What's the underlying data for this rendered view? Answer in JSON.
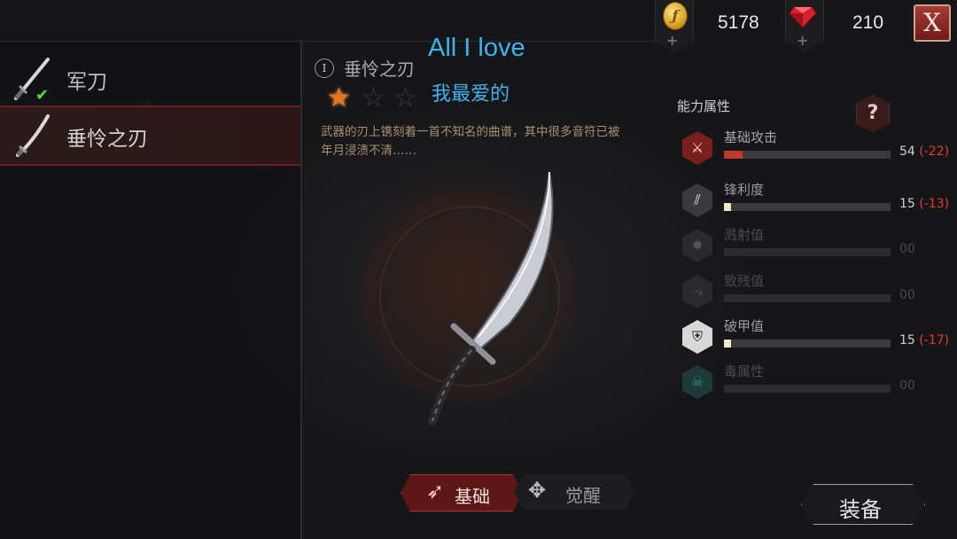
{
  "currency": {
    "coin_value": "5178",
    "gem_value": "210",
    "coin_symbol": "ƒ",
    "close_label": "X"
  },
  "weapon_list": {
    "items": [
      {
        "label": "军刀",
        "equipped": true
      },
      {
        "label": "垂怜之刃",
        "selected": true
      }
    ]
  },
  "weapon": {
    "rank": "I",
    "name": "垂怜之刃",
    "stars_total": 3,
    "stars_earned": 1,
    "description": "武器的刃上镌刻着一首不知名的曲谱，其中很多音符已被年月浸渍不清……"
  },
  "captions": {
    "line1": "All I love",
    "line2": "我最爱的"
  },
  "attributes": {
    "title": "能力属性",
    "help_label": "?",
    "stats": [
      {
        "name": "基础攻击",
        "value": "54",
        "delta": "(-22)",
        "fill": 0.11,
        "icon": "attack-icon",
        "active": true,
        "color": "#c0392b"
      },
      {
        "name": "锋利度",
        "value": "15",
        "delta": "(-13)",
        "fill": 0.04,
        "icon": "sharpness-icon",
        "active": true,
        "color": "#f0e6c8"
      },
      {
        "name": "溅射值",
        "value": "00",
        "delta": "",
        "fill": 0,
        "icon": "splash-icon",
        "active": false,
        "color": "#555555"
      },
      {
        "name": "致残值",
        "value": "00",
        "delta": "",
        "fill": 0,
        "icon": "cripple-icon",
        "active": false,
        "color": "#555555"
      },
      {
        "name": "破甲值",
        "value": "15",
        "delta": "(-17)",
        "fill": 0.04,
        "icon": "armor-break-icon",
        "active": true,
        "color": "#f0e6c8"
      },
      {
        "name": "毒属性",
        "value": "00",
        "delta": "",
        "fill": 0,
        "icon": "poison-skull-icon",
        "active": false,
        "color": "#2a6e6a"
      }
    ]
  },
  "tabs": {
    "basic": "基础",
    "awaken": "觉醒"
  },
  "actions": {
    "equip": "装备"
  }
}
